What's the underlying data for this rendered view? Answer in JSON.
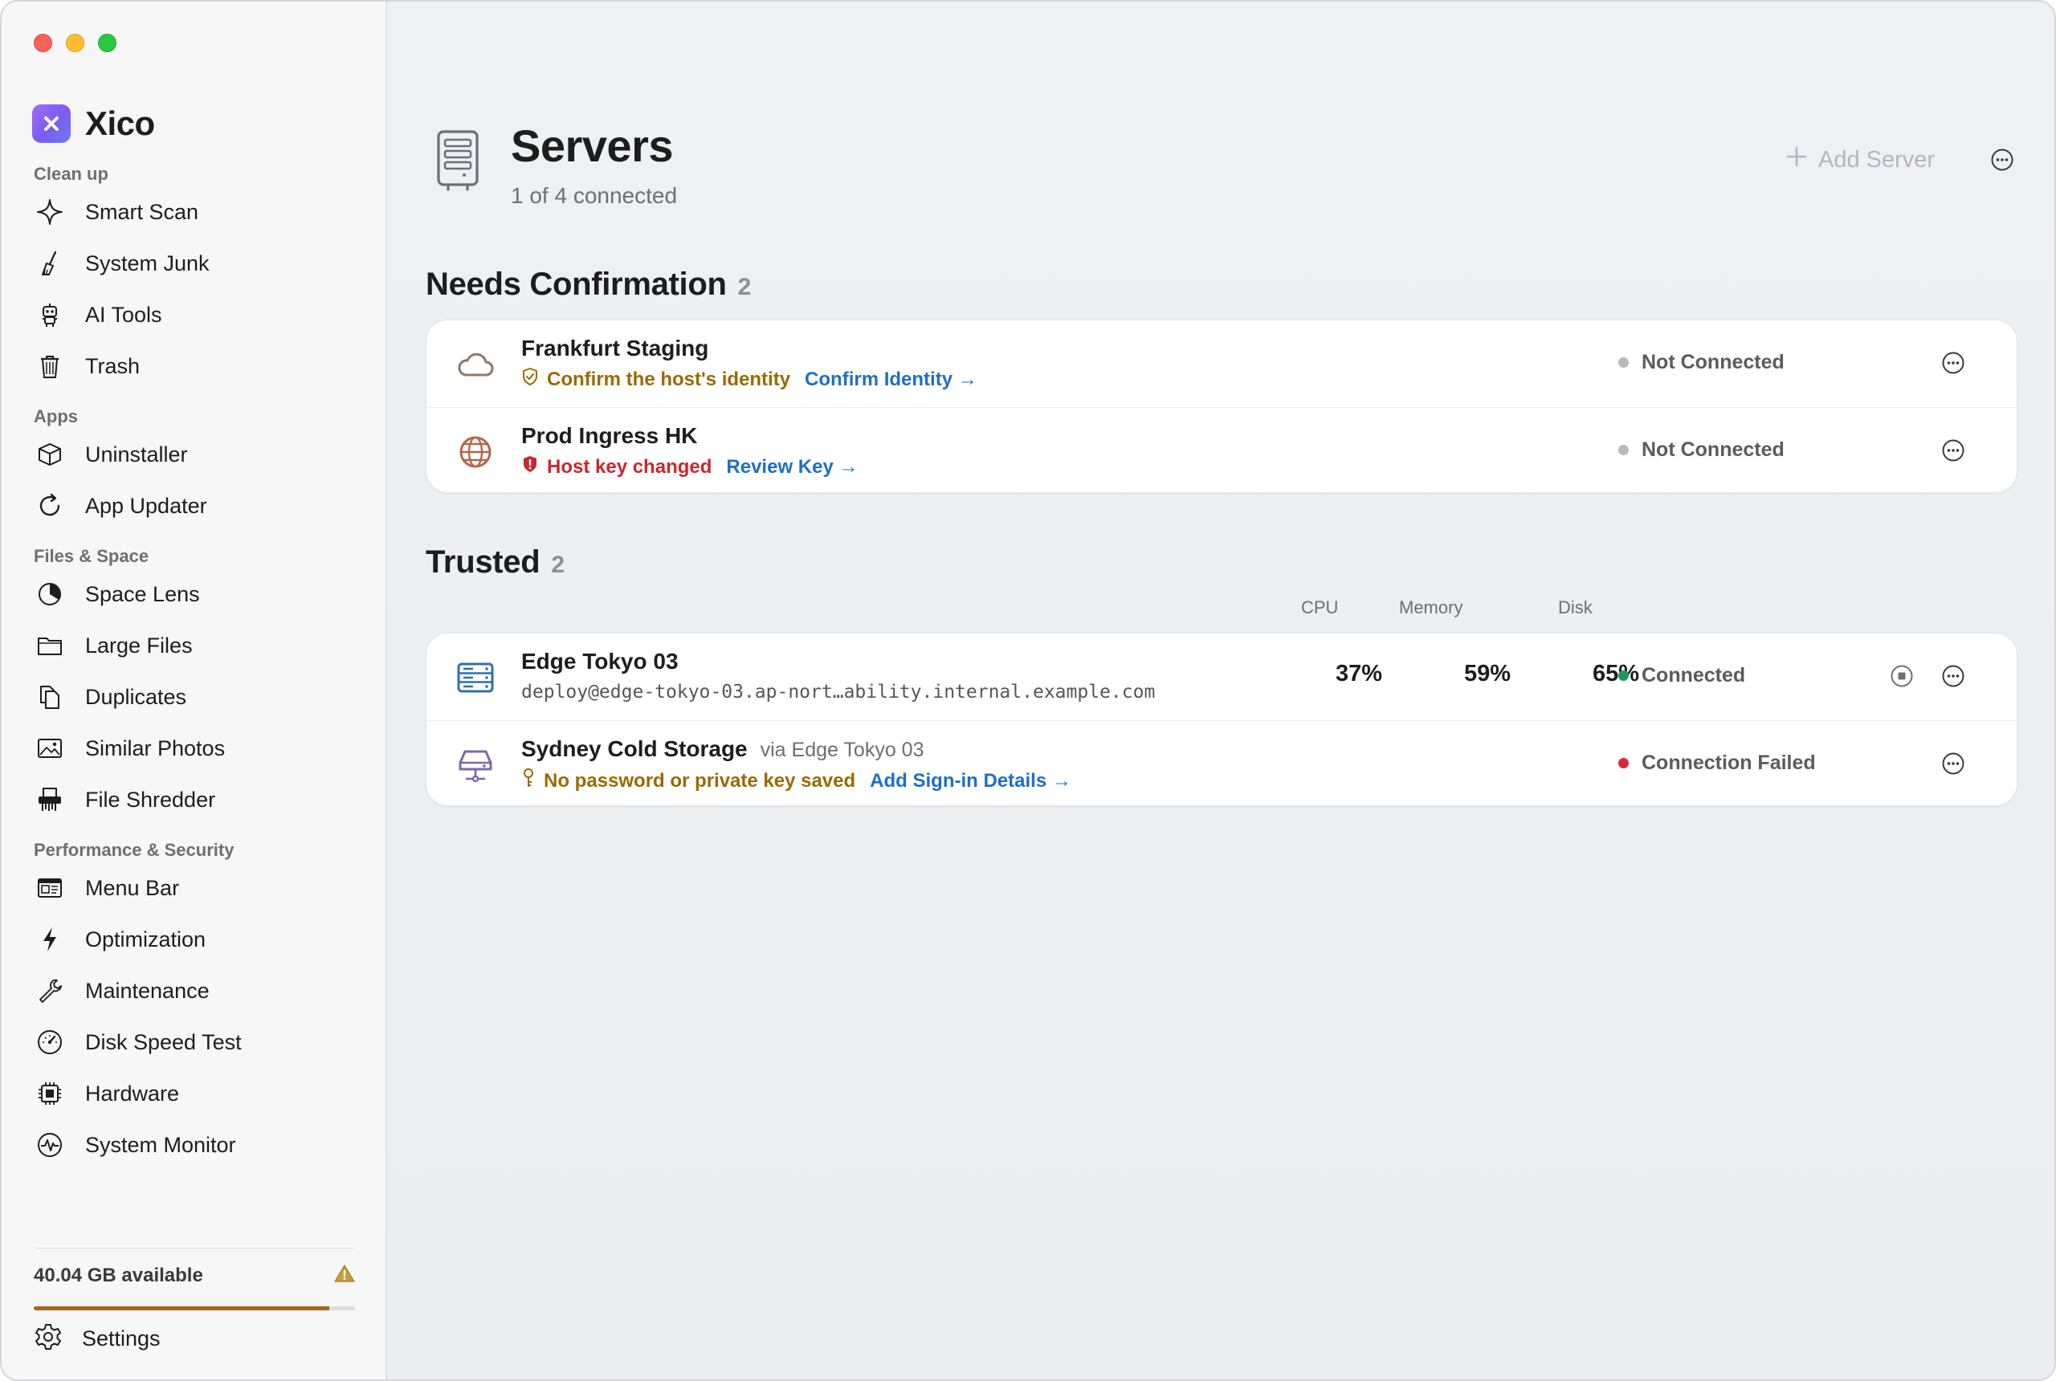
{
  "app": {
    "name": "Xico"
  },
  "sidebar": {
    "sections": [
      {
        "title": "Clean up",
        "items": [
          {
            "label": "Smart Scan",
            "icon": "sparkle-icon"
          },
          {
            "label": "System Junk",
            "icon": "broom-icon"
          },
          {
            "label": "AI Tools",
            "icon": "robot-icon"
          },
          {
            "label": "Trash",
            "icon": "trash-icon"
          }
        ]
      },
      {
        "title": "Apps",
        "items": [
          {
            "label": "Uninstaller",
            "icon": "box-icon"
          },
          {
            "label": "App Updater",
            "icon": "refresh-icon"
          }
        ]
      },
      {
        "title": "Files & Space",
        "items": [
          {
            "label": "Space Lens",
            "icon": "pie-icon"
          },
          {
            "label": "Large Files",
            "icon": "folder-icon"
          },
          {
            "label": "Duplicates",
            "icon": "duplicate-icon"
          },
          {
            "label": "Similar Photos",
            "icon": "photo-icon"
          },
          {
            "label": "File Shredder",
            "icon": "shredder-icon"
          }
        ]
      },
      {
        "title": "Performance & Security",
        "items": [
          {
            "label": "Menu Bar",
            "icon": "menubar-icon"
          },
          {
            "label": "Optimization",
            "icon": "bolt-icon"
          },
          {
            "label": "Maintenance",
            "icon": "wrench-icon"
          },
          {
            "label": "Disk Speed Test",
            "icon": "gauge-icon"
          },
          {
            "label": "Hardware",
            "icon": "chip-icon"
          },
          {
            "label": "System Monitor",
            "icon": "pulse-icon"
          }
        ]
      }
    ],
    "storage": {
      "text": "40.04 GB available",
      "used_fraction": 0.92,
      "warning_icon": "warning-icon"
    },
    "settings_label": "Settings"
  },
  "header": {
    "title": "Servers",
    "subtitle": "1 of 4 connected",
    "add_button": "Add Server"
  },
  "groups": {
    "needs_confirmation": {
      "title": "Needs Confirmation",
      "count": "2",
      "rows": [
        {
          "name": "Frankfurt Staging",
          "icon": "cloud-icon",
          "message": "Confirm the host's identity",
          "message_icon": "shield-check-icon",
          "message_color": "#9a6a00",
          "action": "Confirm Identity →",
          "status": "Not Connected",
          "status_color": "#b8b9be"
        },
        {
          "name": "Prod Ingress HK",
          "icon": "globe-icon",
          "message": "Host key changed",
          "message_icon": "shield-alert-icon",
          "message_color": "#c8282f",
          "action": "Review Key →",
          "status": "Not Connected",
          "status_color": "#b8b9be"
        }
      ]
    },
    "trusted": {
      "title": "Trusted",
      "count": "2",
      "columns": {
        "cpu": "CPU",
        "memory": "Memory",
        "disk": "Disk"
      },
      "rows": [
        {
          "name": "Edge Tokyo 03",
          "icon": "server-rack-icon",
          "host": "deploy@edge-tokyo-03.ap-nort…ability.internal.example.com",
          "cpu": "37%",
          "memory": "59%",
          "disk": "65%",
          "status": "Connected",
          "status_color": "#1f9a5b"
        },
        {
          "name": "Sydney Cold Storage",
          "via": "via Edge Tokyo 03",
          "icon": "drive-network-icon",
          "message": "No password or private key saved",
          "message_icon": "key-icon",
          "message_color": "#9a6a00",
          "action": "Add Sign-in Details →",
          "status": "Connection Failed",
          "status_color": "#d8283a"
        }
      ]
    }
  }
}
